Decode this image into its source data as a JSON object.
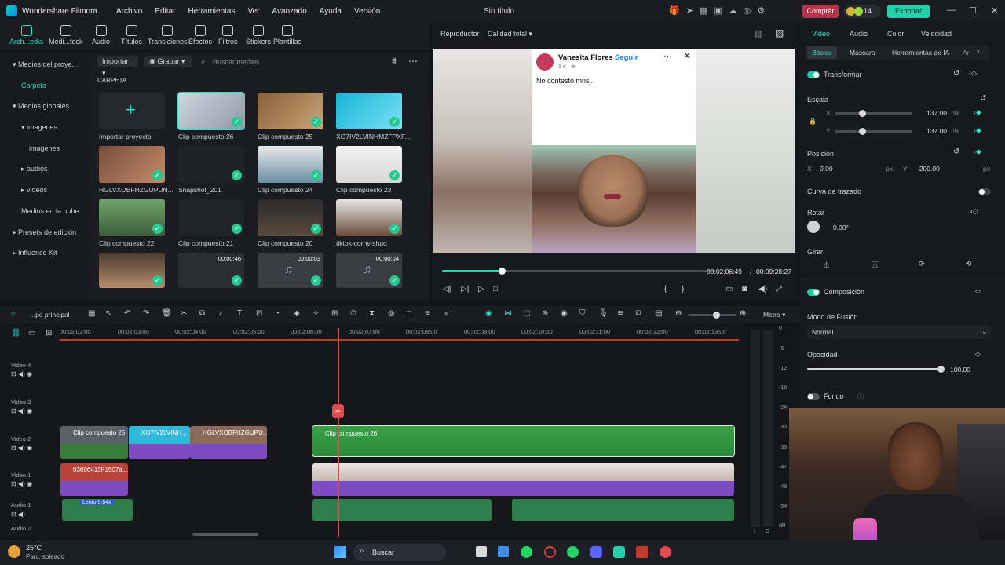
{
  "app": {
    "name": "Wondershare Filmora",
    "window_title": "Sin título",
    "menu": [
      "Archivo",
      "Editar",
      "Herramientas",
      "Ver",
      "Avanzado",
      "Ayuda",
      "Versión"
    ],
    "buy_label": "Comprar",
    "credits": "14",
    "export_label": "Exportar",
    "win_minimize": "—",
    "win_maximize": "☐",
    "win_close": "✕"
  },
  "toolbar": {
    "items": [
      "Arch...edia",
      "Medi...tock",
      "Audio",
      "Títulos",
      "Transiciones",
      "Efectos",
      "Filtros",
      "Stickers",
      "Plantillas"
    ]
  },
  "leftnav": {
    "items": [
      "Medios del proye...",
      "Carpeta",
      "Medios globales",
      "imagenes",
      "imagenes",
      "audios",
      "videos",
      "Medios en la nube",
      "Presets de edición",
      "Influence Kit"
    ]
  },
  "media": {
    "import_label": "Importar",
    "record_label": "Grabar",
    "search_placeholder": "Buscar medios",
    "section": "CARPETA",
    "items": [
      {
        "label": "Importar proyecto"
      },
      {
        "label": "Clip compuesto 26"
      },
      {
        "label": "Clip compuesto 25"
      },
      {
        "label": "XO7IV2LVINHMZFPXF..."
      },
      {
        "label": "HGLVXOBFHZGUPUN..."
      },
      {
        "label": "Snapshot_201"
      },
      {
        "label": "Clip compuesto 24"
      },
      {
        "label": "Clip compuesto 23"
      },
      {
        "label": "Clip compuesto 22"
      },
      {
        "label": "Clip compuesto 21"
      },
      {
        "label": "Clip compuesto 20"
      },
      {
        "label": "tiktok-corny-shaq"
      },
      {
        "label": ""
      },
      {
        "label": "",
        "duration": "00:00:46"
      },
      {
        "label": "",
        "duration": "00:00:03"
      },
      {
        "label": "",
        "duration": "00:00:04"
      }
    ]
  },
  "player": {
    "label": "Reproductor",
    "quality": "Calidad total",
    "post_name": "Vanesita Flores",
    "post_follow": "Seguir",
    "post_meta": "1 d · ⊕",
    "post_text": "No contesto mnsj.",
    "current_time": "00:02:06:49",
    "total_time": "00:09:28:27",
    "progress": 0.22
  },
  "inspector": {
    "tabs": [
      "Video",
      "Audio",
      "Color",
      "Velocidad"
    ],
    "subtabs": [
      "Básico",
      "Máscara",
      "Herramientas de IA",
      "Ar"
    ],
    "transform": "Transformar",
    "scale": "Escala",
    "scale_x": "137.00",
    "scale_y": "137.00",
    "percent": "%",
    "x_axis": "X",
    "y_axis": "Y",
    "position": "Posición",
    "pos_x": "0.00",
    "pos_y": "-200.00",
    "px": "px",
    "path_curve": "Curva de trazado",
    "rotate": "Rotar",
    "rotate_value": "0.00°",
    "flip": "Girar",
    "composition": "Composición",
    "blend_mode": "Modo de Fusión",
    "blend_value": "Normal",
    "opacity": "Opacidad",
    "opacity_value": "100.00",
    "background": "Fondo"
  },
  "timeline": {
    "project": "...po principal",
    "meter_mode": "Metro",
    "ruler": [
      "00:02:02:00",
      "00:02:03:00",
      "00:02:04:00",
      "00:02:05:00",
      "00:02:06:00",
      "00:02:07:00",
      "00:02:08:00",
      "00:02:09:00",
      "00:02:10:00",
      "00:02:11:00",
      "00:02:12:00",
      "00:02:13:00"
    ],
    "tracks": [
      "Video 4",
      "Video 3",
      "Video 2",
      "Video 1",
      "Audio 1",
      "Audio 2"
    ],
    "clips": {
      "v2a": "Clip compuesto 25",
      "v2b": "XO7IV2LVINH...",
      "v2c": "HGLVXOBFHZGUPU...",
      "v2d": "Clip compuesto 26",
      "v1a": "03696413F1507a...",
      "a1speed": "Lento 0.64x"
    },
    "db_scale": [
      "0",
      "-6",
      "-12",
      "-18",
      "-24",
      "-30",
      "-36",
      "-42",
      "-48",
      "-54",
      "dB"
    ],
    "meter_lr": [
      "I",
      "D"
    ]
  },
  "taskbar": {
    "temp": "25°C",
    "weather": "Parc. soleado",
    "search": "Buscar"
  }
}
